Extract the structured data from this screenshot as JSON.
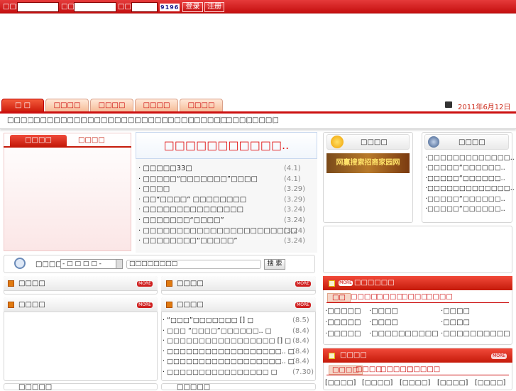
{
  "login": {
    "user_label": "□□□",
    "pass_label": "□□□",
    "code_label": "□□□",
    "captcha": "9196",
    "login_button": "登录",
    "register_button": "注册"
  },
  "nav": {
    "tabs": [
      "□ □",
      "□□□□",
      "□□□□",
      "□□□□",
      "□□□□"
    ],
    "date": "2011年6月12日 □□□",
    "subnav": [
      "□□□□",
      "□□□□",
      "□□□□",
      "□□□□",
      "□□□□",
      "□□□□",
      "□□□□",
      "□□□□□",
      "□□□□",
      "□□□□"
    ]
  },
  "photo": {
    "tab_active": "□□□□",
    "tab_inactive": "□□□□"
  },
  "headline": {
    "title": "□□□□□□□□□□□..",
    "items": [
      {
        "text": "· □□□□□33□",
        "date": "(4.1)"
      },
      {
        "text": "· □□□□□“□□□□□□□”□□□□",
        "date": "(4.1)"
      },
      {
        "text": "· □□□□",
        "date": "(3.29)"
      },
      {
        "text": "· □□“□□□□” □□□□□□□□",
        "date": "(3.29)"
      },
      {
        "text": "· □□□□□□□□□□□□□□□",
        "date": "(3.24)"
      },
      {
        "text": "· □□□□□□□“□□□□”",
        "date": "(3.24)"
      },
      {
        "text": "· □□□□□□□□□□□□□□□□□□□□□□□",
        "date": "(3.24)"
      },
      {
        "text": "· □□□□□□□□“□□□□□”",
        "date": "(3.24)"
      }
    ]
  },
  "search": {
    "label": "□□□□ □",
    "select": "- □ □ □ □ -",
    "input": "□□□□□□□□",
    "button": "搜 索"
  },
  "box1": {
    "title": "□□□□",
    "banner": "网赢搜索招商家园网"
  },
  "box2": {
    "title": "□□□□",
    "items": [
      "·□□□□□□□□□□□□□..",
      "·□□□□□“□□□□□□..",
      "·□□□□□“□□□□□□..",
      "·□□□□□□□□□□□□□..",
      "·□□□□□“□□□□□□..",
      "·□□□□□“□□□□□□.."
    ]
  },
  "col1": {
    "t1": "□□□□",
    "t2": "□□□□",
    "t3": "□□□□□"
  },
  "col2": {
    "t1": "□□□□",
    "t2": "□□□□",
    "t3": "□□□□□",
    "items": [
      {
        "text": "· “□□□”□□□□□□□ [] □",
        "date": "(8.5)"
      },
      {
        "text": "· □□□ “□□□□”□□□□□□.. □",
        "date": "(8.4)"
      },
      {
        "text": "· □□□□□□□□□□□□□□□□□ [] □",
        "date": "(8.4)"
      },
      {
        "text": "· □□□□□□□□□□□□□□□□□□.. □",
        "date": "(8.4)"
      },
      {
        "text": "· □□□□□□□□□□□□□□□□□□.. □",
        "date": "(8.4)"
      },
      {
        "text": "· □□□□□□□□□□□□□□□□ □",
        "date": "(7.30)"
      }
    ]
  },
  "panel1": {
    "title": "□□□□□□",
    "more": "MORE",
    "tabs": [
      "□□",
      "□□□□",
      "□□□□",
      "□□□□",
      "□□□□"
    ],
    "cells": [
      "·□□□□□",
      "·□□□□",
      "·□□□□",
      "·□□□□□",
      "·□□□□",
      "·□□□□",
      "·□□□□□",
      "·□□□□□□□□□□",
      "·□□□□□□□□□□"
    ]
  },
  "panel2": {
    "title": "□□□□",
    "more": "MORE",
    "tabs": [
      "□□□□",
      "□□□□",
      "□□□□□",
      "□□□□□"
    ],
    "links": [
      "[□□□□]",
      "[□□□□]",
      "[□□□□]",
      "[□□□□]",
      "[□□□□]"
    ]
  }
}
